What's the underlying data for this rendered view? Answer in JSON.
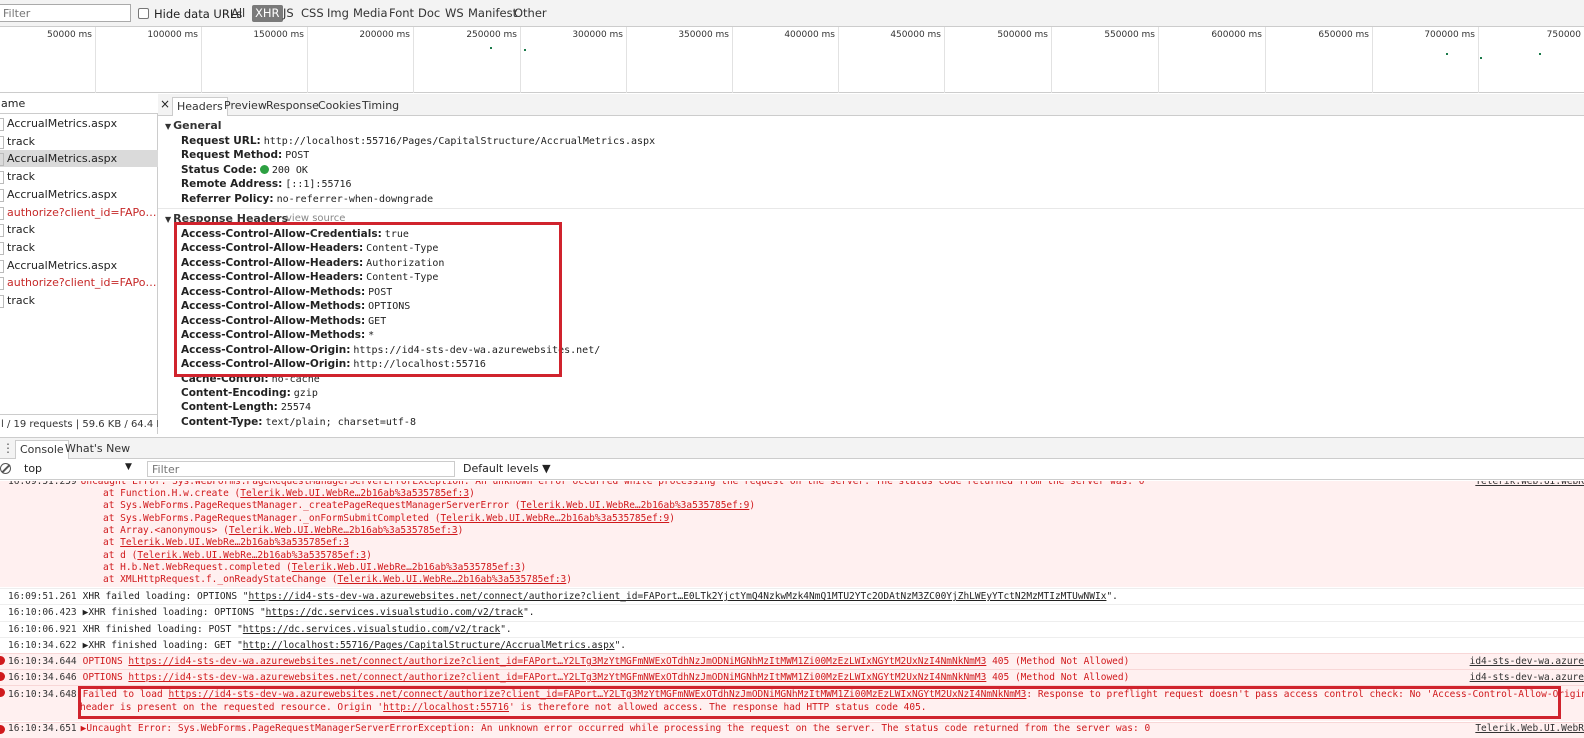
{
  "filterbar": {
    "filter_placeholder": "Filter",
    "hide_data_urls": "Hide data URLs",
    "types": [
      "All",
      "XHR",
      "JS",
      "CSS",
      "Img",
      "Media",
      "Font",
      "Doc",
      "WS",
      "Manifest",
      "Other"
    ],
    "active_type": "XHR"
  },
  "overview": {
    "ticks": [
      "50000 ms",
      "100000 ms",
      "150000 ms",
      "200000 ms",
      "250000 ms",
      "300000 ms",
      "350000 ms",
      "400000 ms",
      "450000 ms",
      "500000 ms",
      "550000 ms",
      "600000 ms",
      "650000 ms",
      "700000 ms",
      "750000"
    ]
  },
  "requests": {
    "header": "ame",
    "items": [
      {
        "name": "AccrualMetrics.aspx",
        "status": "normal"
      },
      {
        "name": "track",
        "status": "normal"
      },
      {
        "name": "AccrualMetrics.aspx",
        "status": "selected"
      },
      {
        "name": "track",
        "status": "normal"
      },
      {
        "name": "AccrualMetrics.aspx",
        "status": "normal"
      },
      {
        "name": "authorize?client_id=FAPortal_...",
        "status": "error"
      },
      {
        "name": "track",
        "status": "normal"
      },
      {
        "name": "track",
        "status": "normal"
      },
      {
        "name": "AccrualMetrics.aspx",
        "status": "normal"
      },
      {
        "name": "authorize?client_id=FAPortal_...",
        "status": "error"
      },
      {
        "name": "track",
        "status": "normal"
      }
    ],
    "summary": "l / 19 requests | 59.6 KB / 64.4 K..."
  },
  "details": {
    "close": "×",
    "tabs": [
      "Headers",
      "Preview",
      "Response",
      "Cookies",
      "Timing"
    ],
    "active_tab": "Headers",
    "general": {
      "title": "General",
      "rows": [
        {
          "k": "Request URL:",
          "v": "http://localhost:55716/Pages/CapitalStructure/AccrualMetrics.aspx"
        },
        {
          "k": "Request Method:",
          "v": "POST"
        },
        {
          "k": "Status Code:",
          "v": "200 OK"
        },
        {
          "k": "Remote Address:",
          "v": "[::1]:55716"
        },
        {
          "k": "Referrer Policy:",
          "v": "no-referrer-when-downgrade"
        }
      ]
    },
    "response_headers": {
      "title": "Response Headers",
      "view_source": "view source",
      "rows": [
        {
          "k": "Access-Control-Allow-Credentials:",
          "v": "true"
        },
        {
          "k": "Access-Control-Allow-Headers:",
          "v": "Content-Type"
        },
        {
          "k": "Access-Control-Allow-Headers:",
          "v": "Authorization"
        },
        {
          "k": "Access-Control-Allow-Headers:",
          "v": "Content-Type"
        },
        {
          "k": "Access-Control-Allow-Methods:",
          "v": "POST"
        },
        {
          "k": "Access-Control-Allow-Methods:",
          "v": "OPTIONS"
        },
        {
          "k": "Access-Control-Allow-Methods:",
          "v": "GET"
        },
        {
          "k": "Access-Control-Allow-Methods:",
          "v": "*"
        },
        {
          "k": "Access-Control-Allow-Origin:",
          "v": "https://id4-sts-dev-wa.azurewebsites.net/"
        },
        {
          "k": "Access-Control-Allow-Origin:",
          "v": "http://localhost:55716"
        },
        {
          "k": "Cache-Control:",
          "v": "no-cache"
        },
        {
          "k": "Content-Encoding:",
          "v": "gzip"
        },
        {
          "k": "Content-Length:",
          "v": "25574"
        },
        {
          "k": "Content-Type:",
          "v": "text/plain; charset=utf-8"
        }
      ]
    }
  },
  "drawer": {
    "tabs": [
      "Console",
      "What's New"
    ],
    "active_tab": "Console",
    "context": "top",
    "filter_placeholder": "Filter",
    "levels": "Default levels ▼"
  },
  "console": {
    "stack_lines": [
      {
        "pre": "at Function.H.w.create (",
        "link": "Telerik.Web.UI.WebRe…2b16ab%3a535785ef:3",
        "post": ")"
      },
      {
        "pre": "at Sys.WebForms.PageRequestManager._createPageRequestManagerServerError (",
        "link": "Telerik.Web.UI.WebRe…2b16ab%3a535785ef:9",
        "post": ")"
      },
      {
        "pre": "at Sys.WebForms.PageRequestManager._onFormSubmitCompleted (",
        "link": "Telerik.Web.UI.WebRe…2b16ab%3a535785ef:9",
        "post": ")"
      },
      {
        "pre": "at Array.<anonymous> (",
        "link": "Telerik.Web.UI.WebRe…2b16ab%3a535785ef:3",
        "post": ")"
      },
      {
        "pre": "at ",
        "link": "Telerik.Web.UI.WebRe…2b16ab%3a535785ef:3",
        "post": ""
      },
      {
        "pre": "at d (",
        "link": "Telerik.Web.UI.WebRe…2b16ab%3a535785ef:3",
        "post": ")"
      },
      {
        "pre": "at H.b.Net.WebRequest.completed (",
        "link": "Telerik.Web.UI.WebRe…2b16ab%3a535785ef:3",
        "post": ")"
      },
      {
        "pre": "at XMLHttpRequest.f._onReadyStateChange (",
        "link": "Telerik.Web.UI.WebRe…2b16ab%3a535785ef:3",
        "post": ")"
      }
    ],
    "top_error_fragment": "Uncaught Error: Sys.WebForms.PageRequestManagerServerErrorException: An unknown error occurred while processing the request on the server. The status code returned from the server was: 0",
    "top_error_ts": "16:09:51.259",
    "top_error_src": "Telerik.Web.UI.WebR",
    "messages": [
      {
        "ts": "16:09:51.261",
        "pre": "XHR failed loading: OPTIONS \"",
        "link": "https://id4-sts-dev-wa.azurewebsites.net/connect/authorize?client_id=FAPort…E0LTk2YjctYmQ4NzkwMzk4NmQ1MTU2YTc2ODAtNzM3ZC00YjZhLWEyYTctN2MzMTIzMTUwNWIx",
        "post": "\"."
      },
      {
        "ts": "16:10:06.423",
        "pre": "▶XHR finished loading: OPTIONS \"",
        "link": "https://dc.services.visualstudio.com/v2/track",
        "post": "\"."
      },
      {
        "ts": "16:10:06.921",
        "pre": "XHR finished loading: POST \"",
        "link": "https://dc.services.visualstudio.com/v2/track",
        "post": "\"."
      },
      {
        "ts": "16:10:34.622",
        "pre": "▶XHR finished loading: GET \"",
        "link": "http://localhost:55716/Pages/CapitalStructure/AccrualMetrics.aspx",
        "post": "\"."
      }
    ],
    "errors": [
      {
        "ts": "16:10:34.644",
        "pre": "OPTIONS ",
        "link": "https://id4-sts-dev-wa.azurewebsites.net/connect/authorize?client_id=FAPort…Y2LTg3MzYtMGFmNWExOTdhNzJmODNiMGNhMzItMWM1Zi00MzEzLWIxNGYtM2UxNzI4NmNkNmM3",
        "post": " 405 (Method Not Allowed)",
        "src": "id4-sts-dev-wa.azure"
      },
      {
        "ts": "16:10:34.646",
        "pre": "OPTIONS ",
        "link": "https://id4-sts-dev-wa.azurewebsites.net/connect/authorize?client_id=FAPort…Y2LTg3MzYtMGFmNWExOTdhNzJmODNiMGNhMzItMWM1Zi00MzEzLWIxNGYtM2UxNzI4NmNkNmM3",
        "post": " 405 (Method Not Allowed)",
        "src": "id4-sts-dev-wa.azure"
      }
    ],
    "cors_error": {
      "ts": "16:10:34.648",
      "line1_pre": "Failed to load ",
      "line1_link": "https://id4-sts-dev-wa.azurewebsites.net/connect/authorize?client_id=FAPort…Y2LTg3MzYtMGFmNWExOTdhNzJmODNiMGNhMzItMWM1Zi00MzEzLWIxNGYtM2UxNzI4NmNkNmM3",
      "line1_post": ": Response to preflight request doesn't pass access control check: No 'Access-Control-Allow-Origin'",
      "line2_pre": "header is present on the requested resource. Origin '",
      "line2_link": "http://localhost:55716",
      "line2_post": "' is therefore not allowed access. The response had HTTP status code 405."
    },
    "bottom_error": {
      "ts": "16:10:34.651",
      "text": "▶Uncaught Error: Sys.WebForms.PageRequestManagerServerErrorException: An unknown error occurred while processing the request on the server. The status code returned from the server was: 0",
      "src": "Telerik.Web.UI.WebR"
    }
  }
}
